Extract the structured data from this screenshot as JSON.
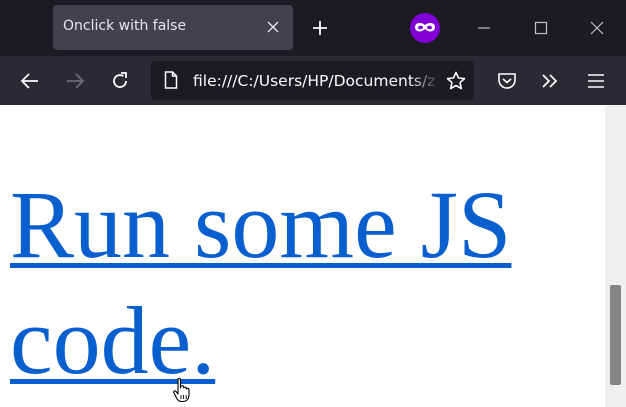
{
  "browser": {
    "tab": {
      "title": "Onclick with false",
      "close_icon": "close-icon"
    },
    "new_tab_icon": "plus-icon",
    "private_browsing_icon": "private-mask-icon",
    "window_controls": [
      "minimize-icon",
      "maximize-icon",
      "close-icon"
    ],
    "toolbar": {
      "back_icon": "arrow-left-icon",
      "forward_icon": "arrow-right-icon",
      "reload_icon": "reload-icon",
      "url": "file:///C:/Users/HP/Documents/z",
      "bookmark_icon": "star-icon",
      "pocket_icon": "pocket-icon",
      "overflow_icon": "double-chevron-icon",
      "menu_icon": "hamburger-icon"
    }
  },
  "page": {
    "link_text": "Run some JS code."
  },
  "colors": {
    "tabstrip_bg": "#1c1b22",
    "tab_bg": "#42414d",
    "toolbar_bg": "#2b2a33",
    "link_color": "#0a5fcf",
    "private_purple": "#8000d7"
  }
}
